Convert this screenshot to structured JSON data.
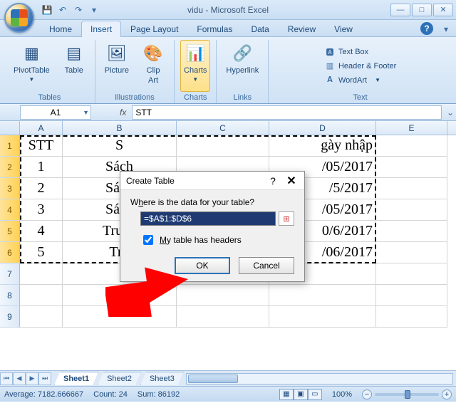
{
  "title": "vidu - Microsoft Excel",
  "tabs": [
    "Home",
    "Insert",
    "Page Layout",
    "Formulas",
    "Data",
    "Review",
    "View"
  ],
  "active_tab": 1,
  "ribbon": {
    "tables": {
      "label": "Tables",
      "pivot": "PivotTable",
      "table": "Table"
    },
    "illus": {
      "label": "Illustrations",
      "picture": "Picture",
      "clipart_l1": "Clip",
      "clipart_l2": "Art"
    },
    "charts": {
      "label": "Charts",
      "btn": "Charts"
    },
    "links": {
      "label": "Links",
      "btn": "Hyperlink"
    },
    "text": {
      "label": "Text",
      "textbox": "Text Box",
      "header": "Header & Footer",
      "wordart": "WordArt"
    }
  },
  "namebox": "A1",
  "formula": "STT",
  "columns": [
    "A",
    "B",
    "C",
    "D",
    "E"
  ],
  "col_widths": {
    "A": 60,
    "B": 160,
    "C": 130,
    "D": 150,
    "E": 100
  },
  "rows": [
    {
      "n": 1,
      "A": "STT",
      "B": "S",
      "D": "gày nhập"
    },
    {
      "n": 2,
      "A": "1",
      "B": "Sách",
      "D": "/05/2017"
    },
    {
      "n": 3,
      "A": "2",
      "B": "Sách",
      "D": "/5/2017"
    },
    {
      "n": 4,
      "A": "3",
      "B": "Sách",
      "D": "/05/2017"
    },
    {
      "n": 5,
      "A": "4",
      "B": "Truyệ",
      "D": "0/6/2017"
    },
    {
      "n": 6,
      "A": "5",
      "B": "Tru",
      "D": "/06/2017"
    },
    {
      "n": 7,
      "A": "",
      "B": "",
      "D": ""
    },
    {
      "n": 8,
      "A": "",
      "B": "",
      "D": ""
    },
    {
      "n": 9,
      "A": "",
      "B": "",
      "D": ""
    }
  ],
  "dialog": {
    "title": "Create Table",
    "prompt_pre": "W",
    "prompt_u": "h",
    "prompt_post": "ere is the data for your table?",
    "range": "=$A$1:$D$6",
    "check_pre": "M",
    "check_u": "y",
    "check_post": " table has headers",
    "ok": "OK",
    "cancel": "Cancel"
  },
  "sheets": [
    "Sheet1",
    "Sheet2",
    "Sheet3"
  ],
  "status": {
    "avg_label": "Average:",
    "avg": "7182.666667",
    "count_label": "Count:",
    "count": "24",
    "sum_label": "Sum:",
    "sum": "86192",
    "zoom": "100%"
  }
}
